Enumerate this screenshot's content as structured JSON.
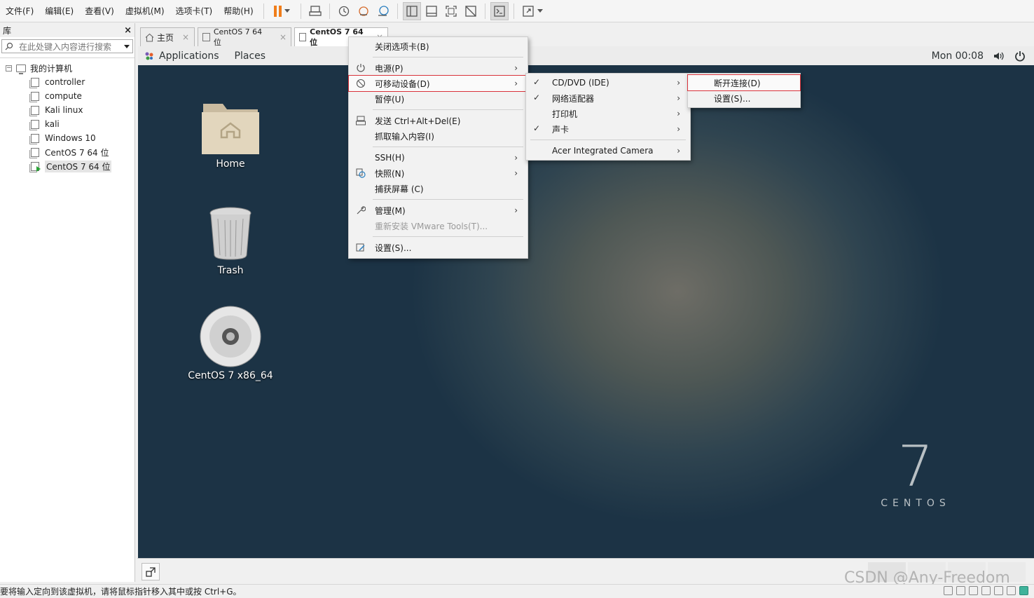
{
  "menubar": {
    "items": [
      "文件(F)",
      "编辑(E)",
      "查看(V)",
      "虚拟机(M)",
      "选项卡(T)",
      "帮助(H)"
    ]
  },
  "library": {
    "title": "库",
    "close": "×",
    "search_placeholder": "在此处键入内容进行搜索",
    "root": "我的计算机",
    "vms": [
      "controller",
      "compute",
      "Kali linux",
      "kali",
      "Windows 10",
      "CentOS 7 64 位",
      "CentOS 7 64 位"
    ]
  },
  "tabs": [
    {
      "label": "主页",
      "close": "×"
    },
    {
      "label": "CentOS 7 64 位",
      "close": "×"
    },
    {
      "label": "CentOS 7 64 位",
      "close": "×"
    }
  ],
  "vm_topbar": {
    "applications": "Applications",
    "places": "Places",
    "clock": "Mon 00:08"
  },
  "desktop": {
    "icons": [
      "Home",
      "Trash",
      "CentOS 7 x86_64"
    ],
    "logo_number": "7",
    "logo_word": "CENTOS"
  },
  "main_menu": {
    "close_tab": "关闭选项卡(B)",
    "power": "电源(P)",
    "removable": "可移动设备(D)",
    "pause": "暂停(U)",
    "send_cad": "发送 Ctrl+Alt+Del(E)",
    "grab_input": "抓取输入内容(I)",
    "ssh": "SSH(H)",
    "snapshot": "快照(N)",
    "capture": "捕获屏幕 (C)",
    "manage": "管理(M)",
    "reinstall_tools": "重新安装 VMware Tools(T)...",
    "settings": "设置(S)..."
  },
  "devices_menu": {
    "cd": "CD/DVD (IDE)",
    "network": "网络适配器",
    "printer": "打印机",
    "sound": "声卡",
    "camera": "Acer Integrated Camera"
  },
  "cd_menu": {
    "disconnect": "断开连接(D)",
    "settings": "设置(S)..."
  },
  "statusbar": {
    "text": "要将输入定向到该虚拟机，请将鼠标指针移入其中或按 Ctrl+G。"
  },
  "watermark": "CSDN @Any-Freedom",
  "colors": {
    "pause_orange": "#f07d1a",
    "highlight_red": "#d9323a",
    "running_green": "#2aa336"
  }
}
